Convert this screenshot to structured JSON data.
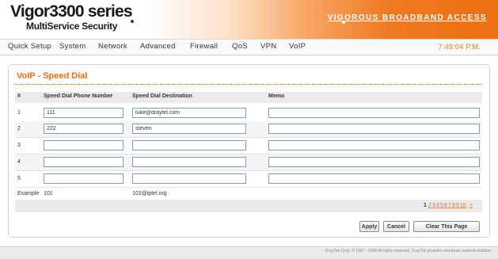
{
  "header": {
    "brand_title": "Vigor3300 series",
    "brand_subtitle": "MultiService Security",
    "tagline": "VIGOROUS  BROADBAND ACCESS"
  },
  "menu": {
    "items": [
      "Quick Setup",
      "System",
      "Network",
      "Advanced",
      "Firewall",
      "QoS",
      "VPN",
      "VoIP"
    ],
    "clock": "7:49:04 P.M."
  },
  "page": {
    "title": "VoIP - Speed Dial",
    "columns": [
      "#",
      "Speed Dial Phone Number",
      "Speed Dial Destination",
      "Memo"
    ],
    "rows": [
      {
        "index": "1",
        "phone": "111",
        "destination": "luke@draytel.com",
        "memo": ""
      },
      {
        "index": "2",
        "phone": "222",
        "destination": "steven",
        "memo": ""
      },
      {
        "index": "3",
        "phone": "",
        "destination": "",
        "memo": ""
      },
      {
        "index": "4",
        "phone": "",
        "destination": "",
        "memo": ""
      },
      {
        "index": "5",
        "phone": "",
        "destination": "",
        "memo": ""
      }
    ],
    "example": {
      "label": "Example",
      "phone": "101",
      "destination": "101@iptel.org"
    },
    "pages": [
      "1",
      "2",
      "3",
      "4",
      "5",
      "6",
      "7",
      "8",
      "9",
      "10",
      ">"
    ],
    "current_page": "1",
    "buttons": {
      "apply": "Apply",
      "cancel": "Cancel",
      "clear": "Clear This Page"
    }
  },
  "footer": {
    "copyright": "DrayTek Corp. © 1997 - 2008 All rights reserved. DrayTek provides enterprise network solution."
  },
  "colors": {
    "accent": "#ee6f10",
    "input_border": "#7f9db9"
  }
}
